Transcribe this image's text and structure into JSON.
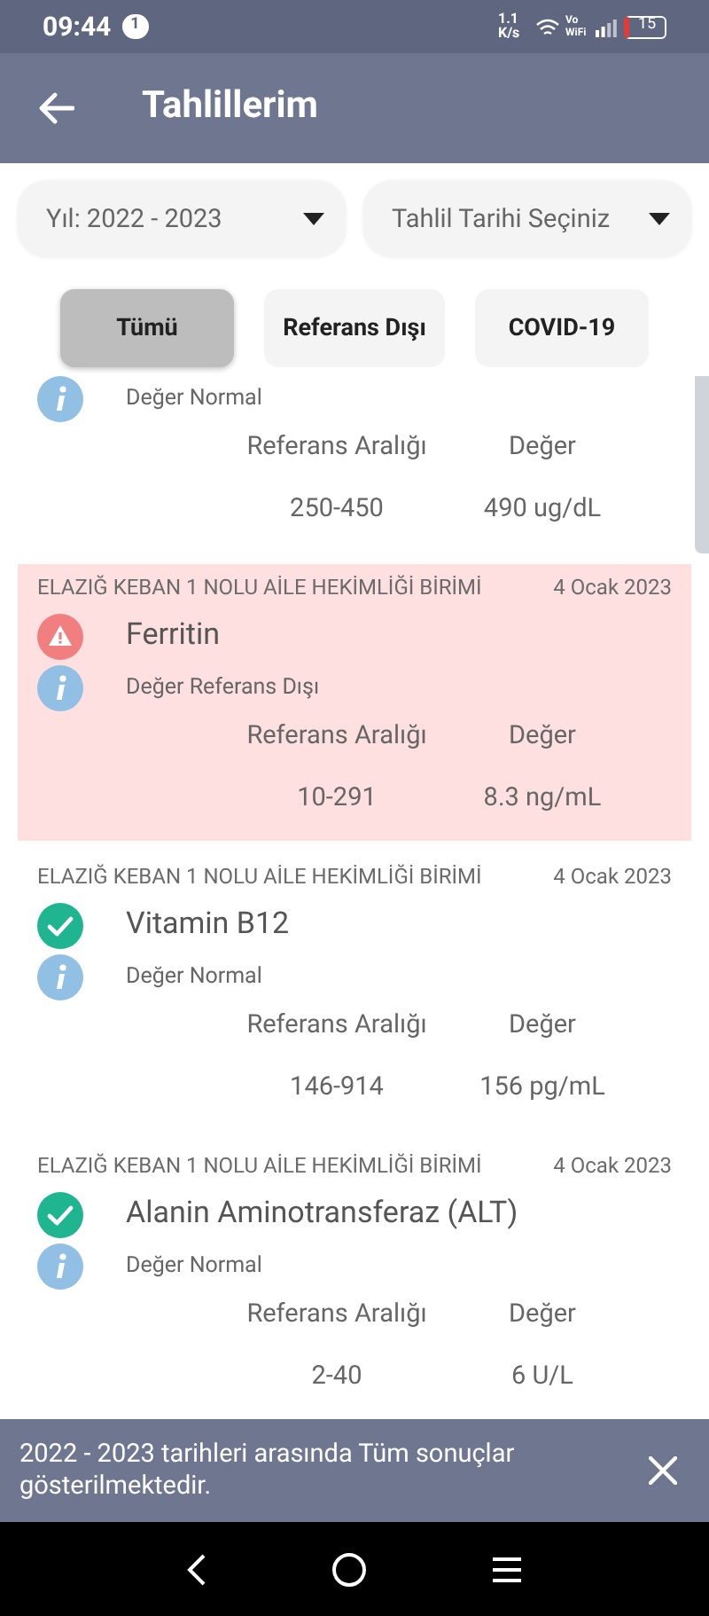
{
  "status_bar": {
    "time": "09:44",
    "notification_count": "1",
    "speed": "1.1 K/s",
    "vowifi": "Vo WiFi",
    "battery": "15"
  },
  "header": {
    "title": "Tahlillerim"
  },
  "filters": [
    {
      "label": "Yıl: 2022 - 2023"
    },
    {
      "label": "Tahlil Tarihi Seçiniz"
    }
  ],
  "tabs": [
    {
      "label": "Tümü",
      "selected": true
    },
    {
      "label": "Referans Dışı",
      "selected": false
    },
    {
      "label": "COVID-19",
      "selected": false
    }
  ],
  "results": [
    {
      "kind": "partial",
      "out_of_range": false,
      "note": "Değer Normal",
      "range_label": "Referans Aralığı",
      "value_label": "Değer",
      "range": "250-450",
      "value": "490 ug/dL"
    },
    {
      "kind": "full",
      "out_of_range": true,
      "facility": "ELAZIĞ KEBAN 1 NOLU AİLE HEKİMLİĞİ BİRİMİ",
      "date": "4 Ocak 2023",
      "name": "Ferritin",
      "note": "Değer Referans Dışı",
      "range_label": "Referans Aralığı",
      "value_label": "Değer",
      "range": "10-291",
      "value": "8.3 ng/mL"
    },
    {
      "kind": "full",
      "out_of_range": false,
      "facility": "ELAZIĞ KEBAN 1 NOLU AİLE HEKİMLİĞİ BİRİMİ",
      "date": "4 Ocak 2023",
      "name": "Vitamin B12",
      "note": "Değer Normal",
      "range_label": "Referans Aralığı",
      "value_label": "Değer",
      "range": "146-914",
      "value": "156 pg/mL"
    },
    {
      "kind": "full",
      "out_of_range": false,
      "facility": "ELAZIĞ KEBAN 1 NOLU AİLE HEKİMLİĞİ BİRİMİ",
      "date": "4 Ocak 2023",
      "name": "Alanin Aminotransferaz (ALT)",
      "note": "Değer Normal",
      "range_label": "Referans Aralığı",
      "value_label": "Değer",
      "range": "2-40",
      "value": "6 U/L"
    }
  ],
  "snackbar": {
    "message": "2022 - 2023 tarihleri arasında Tüm sonuçlar gösterilmektedir."
  }
}
